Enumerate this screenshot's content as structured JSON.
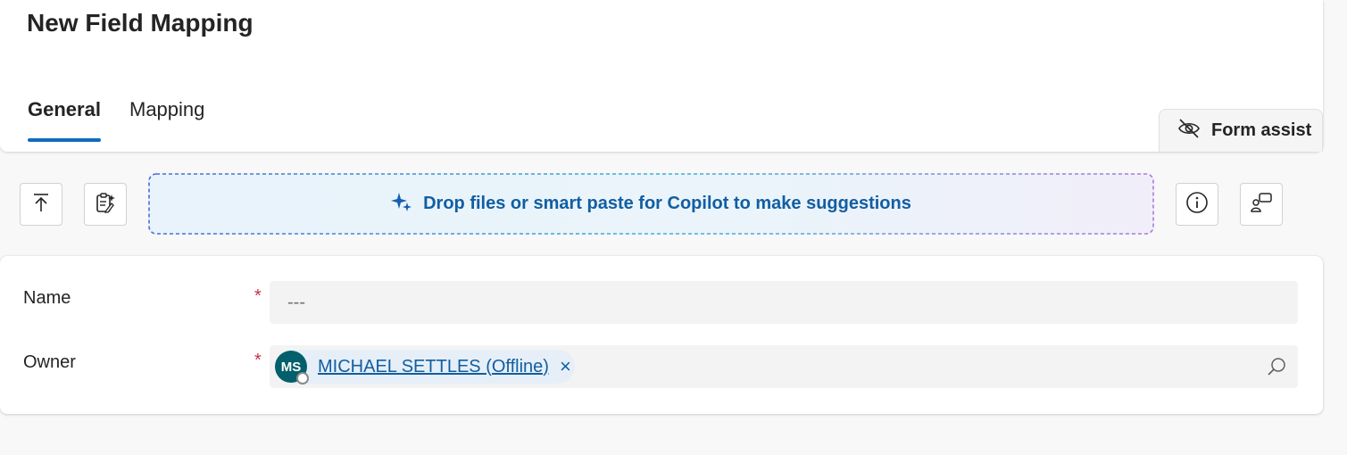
{
  "header": {
    "title": "New Field Mapping",
    "tabs": [
      {
        "label": "General",
        "active": true
      },
      {
        "label": "Mapping",
        "active": false
      }
    ],
    "form_assist_label": "Form assist"
  },
  "toolbar": {
    "dropzone_text": "Drop files or smart paste for Copilot to make suggestions",
    "icons": [
      "upload-icon",
      "smart-paste-icon",
      "info-icon",
      "chat-icon"
    ]
  },
  "form": {
    "name": {
      "label": "Name",
      "required_mark": "*",
      "value": "---"
    },
    "owner": {
      "label": "Owner",
      "required_mark": "*",
      "avatar_initials": "MS",
      "value": "MICHAEL SETTLES (Offline)",
      "remove_glyph": "×"
    }
  },
  "colors": {
    "accent": "#0f6cbd",
    "link": "#115ea3",
    "required": "#c4314b",
    "avatar": "#035f6b"
  }
}
